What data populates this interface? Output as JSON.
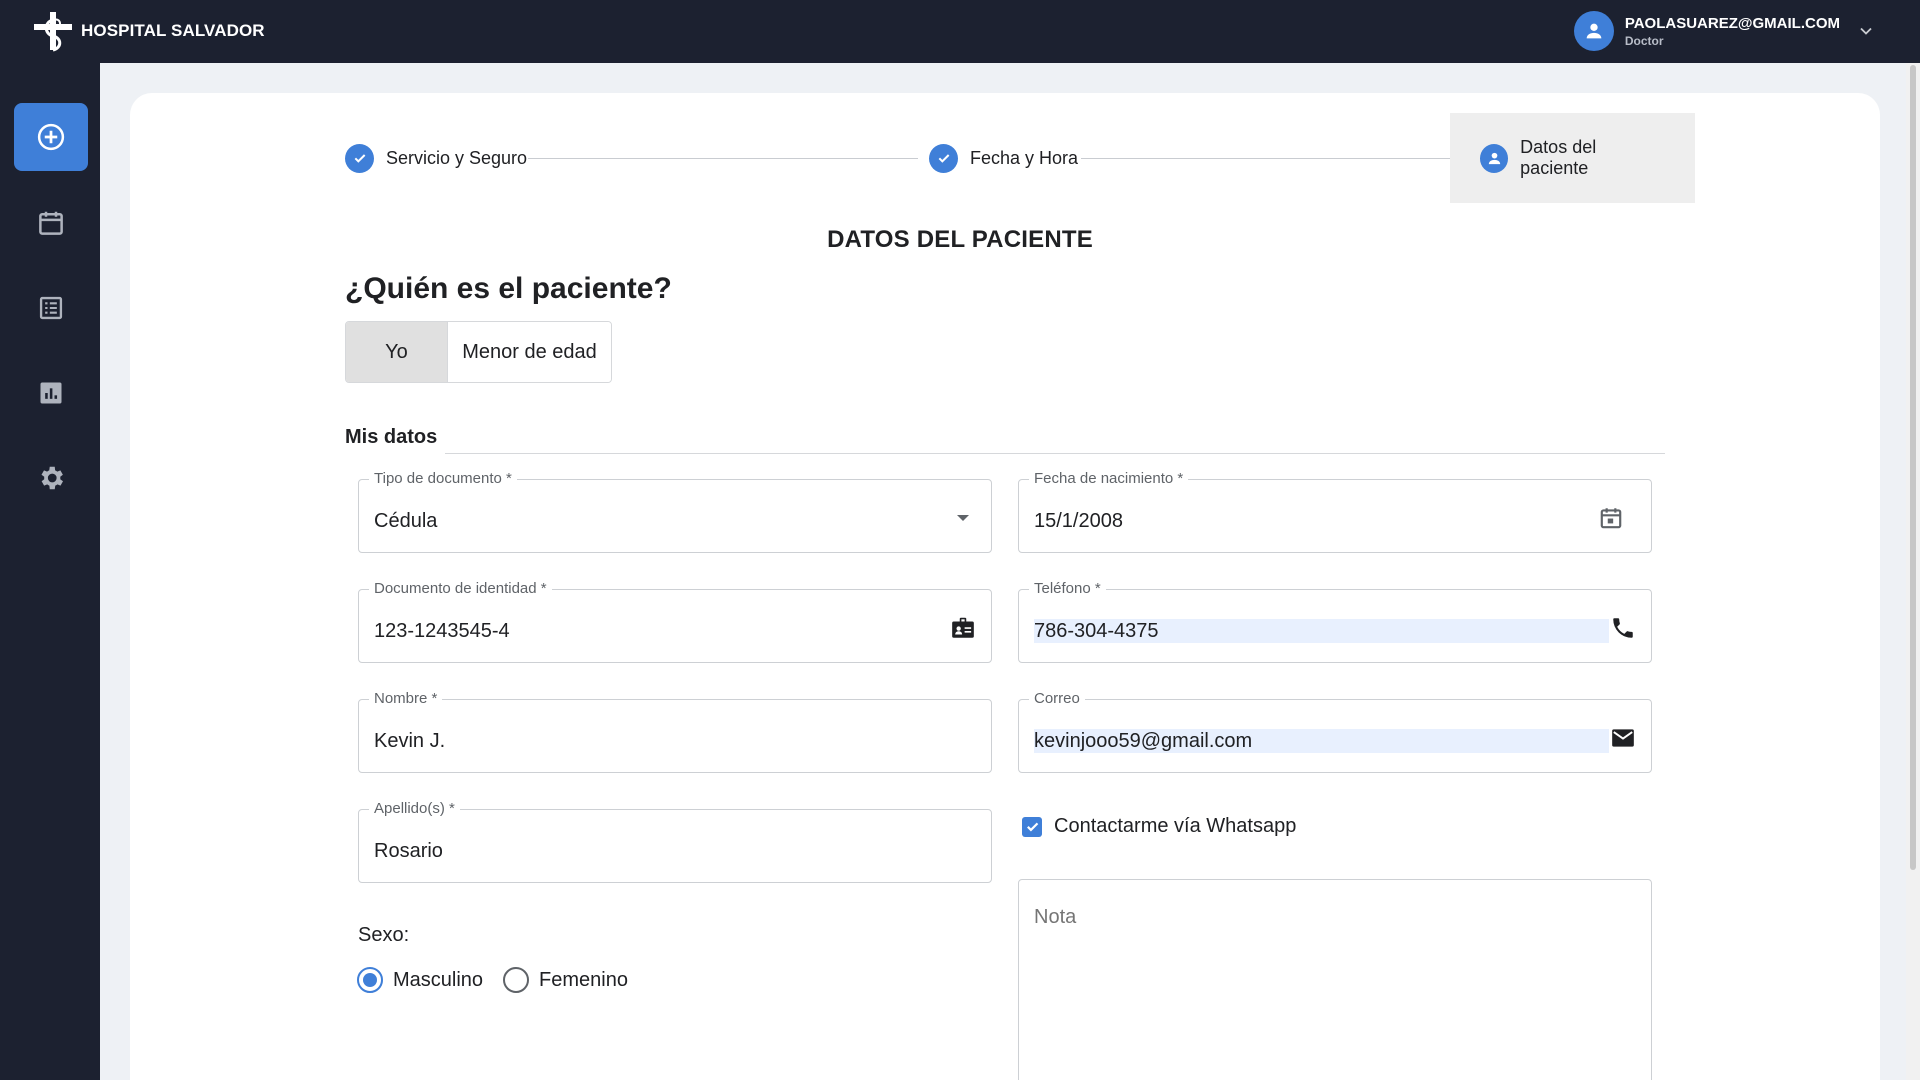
{
  "header": {
    "brand_name": "HOSPITAL SALVADOR",
    "logo_icon": "hospital-cross-logo",
    "user_email": "PAOLASUAREZ@GMAIL.COM",
    "user_role": "Doctor",
    "user_icon": "person-icon",
    "chevron_icon": "chevron-down-icon"
  },
  "sidebar": {
    "items": [
      {
        "icon": "add-circle-icon",
        "active": true
      },
      {
        "icon": "calendar-icon",
        "active": false
      },
      {
        "icon": "list-icon",
        "active": false
      },
      {
        "icon": "bar-chart-icon",
        "active": false
      },
      {
        "icon": "gear-icon",
        "active": false
      }
    ]
  },
  "stepper": {
    "steps": [
      {
        "label": "Servicio y Seguro",
        "status": "done"
      },
      {
        "label": "Fecha y Hora",
        "status": "done"
      },
      {
        "label": "Datos del paciente",
        "status": "current"
      }
    ]
  },
  "main": {
    "section_title": "DATOS DEL PACIENTE",
    "question": "¿Quién es el paciente?",
    "toggle": {
      "selected": "Yo",
      "other": "Menor de edad"
    },
    "divider_title": "Mis datos"
  },
  "form": {
    "tipo_documento": {
      "label": "Tipo de documento *",
      "value": "Cédula"
    },
    "fecha_nacimiento": {
      "label": "Fecha de nacimiento *",
      "value": "15/1/2008"
    },
    "documento_identidad": {
      "label": "Documento de identidad *",
      "value": "123-1243545-4"
    },
    "telefono": {
      "label": "Teléfono *",
      "value": "786-304-4375"
    },
    "nombre": {
      "label": "Nombre *",
      "value": "Kevin J."
    },
    "correo": {
      "label": "Correo",
      "value": "kevinjooo59@gmail.com"
    },
    "apellidos": {
      "label": "Apellido(s) *",
      "value": "Rosario"
    },
    "whatsapp": {
      "label": "Contactarme vía Whatsapp",
      "checked": true
    },
    "nota": {
      "placeholder": "Nota"
    },
    "sexo": {
      "label": "Sexo:",
      "options": [
        {
          "label": "Masculino",
          "selected": true
        },
        {
          "label": "Femenino",
          "selected": false
        }
      ]
    }
  },
  "colors": {
    "nav_bg": "#1c2130",
    "accent": "#3f7fd8",
    "page_bg": "#eef1f5",
    "card_bg": "#ffffff"
  }
}
